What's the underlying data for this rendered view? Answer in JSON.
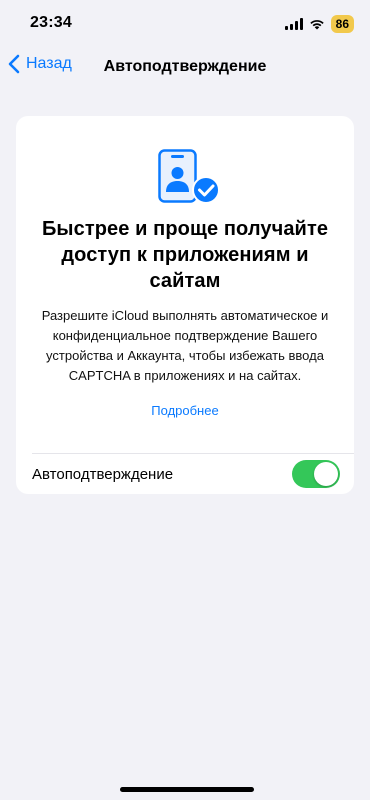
{
  "status_bar": {
    "time": "23:34",
    "battery": "86",
    "icons": [
      "signal-icon",
      "wifi-icon",
      "battery-icon"
    ]
  },
  "nav": {
    "back_label": "Назад",
    "title": "Автоподтверждение"
  },
  "card": {
    "icon": "id-badge-check-icon",
    "headline": "Быстрее и проще получайте доступ к приложениям и сайтам",
    "body": "Разрешите iCloud выполнять автоматическое и конфиденциальное подтверждение Вашего устройства и Аккаунта, чтобы избежать ввода CAPTCHA в приложениях и на сайтах.",
    "link_label": "Подробнее",
    "toggle": {
      "label": "Автоподтверждение",
      "on": true
    }
  },
  "colors": {
    "accent": "#0a7aff",
    "toggle_on": "#34c759",
    "background": "#f2f2f7",
    "battery_badge": "#f2c94c"
  }
}
